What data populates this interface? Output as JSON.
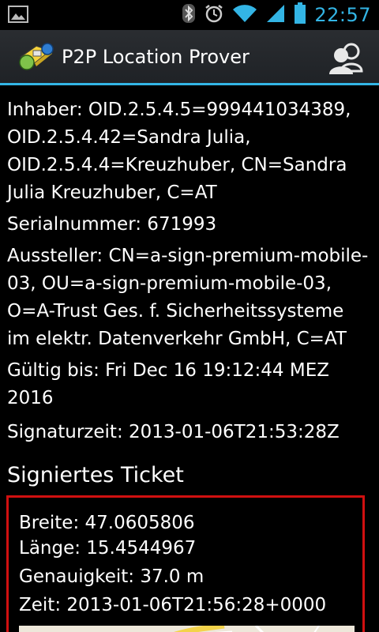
{
  "status_bar": {
    "time": "22:57",
    "icons": [
      "image-notification-icon",
      "bluetooth-icon",
      "alarm-icon",
      "wifi-icon",
      "signal-icon",
      "battery-icon"
    ]
  },
  "action_bar": {
    "title": "P2P Location Prover",
    "app_icon": "app-logo-icon",
    "action_icon": "contacts-icon",
    "accent_color": "#33b5e5"
  },
  "certificate": {
    "inhaber": "Inhaber: OID.2.5.4.5=999441034389, OID.2.5.4.42=Sandra Julia, OID.2.5.4.4=Kreuzhuber, CN=Sandra Julia Kreuzhuber, C=AT",
    "serialnummer": "Serialnummer: 671993",
    "aussteller": "Aussteller: CN=a-sign-premium-mobile-03, OU=a-sign-premium-mobile-03, O=A-Trust Ges. f. Sicherheitssysteme im elektr. Datenverkehr GmbH, C=AT",
    "gueltig": "Gültig bis: Fri Dec 16 19:12:44 MEZ 2016",
    "signaturzeit": "Signaturzeit: 2013-01-06T21:53:28Z"
  },
  "ticket": {
    "title": "Signiertes Ticket",
    "border_color": "#d01010",
    "breite": "Breite: 47.0605806",
    "laenge": "Länge: 15.4544967",
    "genauigkeit": "Genauigkeit: 37.0 m",
    "zeit": "Zeit: 2013-01-06T21:56:28+0000"
  }
}
